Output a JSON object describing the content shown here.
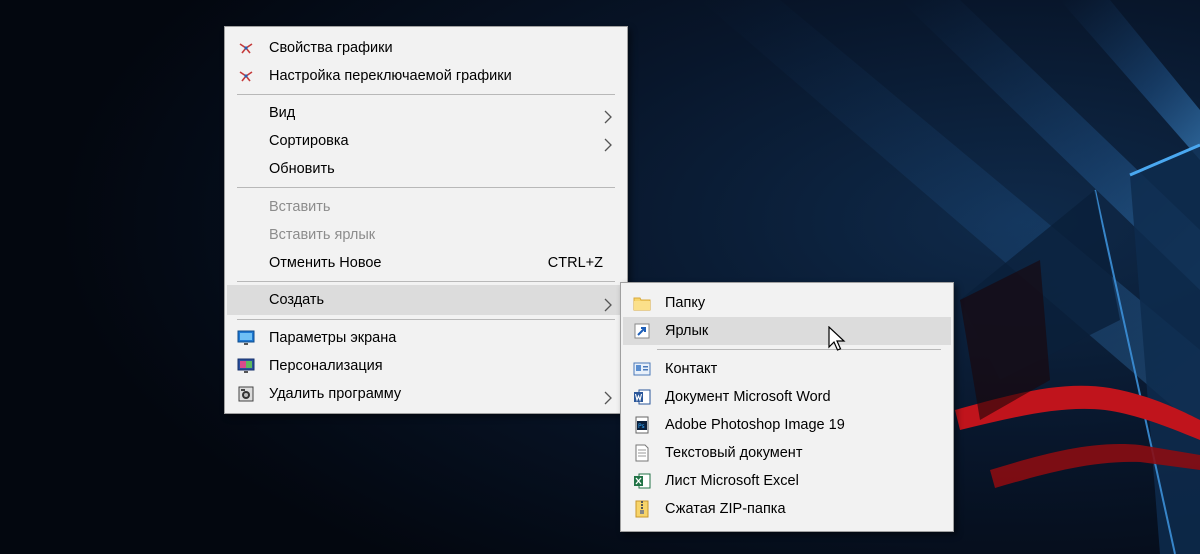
{
  "context_menu": {
    "items": [
      {
        "label": "Свойства графики",
        "icon": "intel-graphics-icon",
        "disabled": false
      },
      {
        "label": "Настройка переключаемой графики",
        "icon": "intel-graphics-icon",
        "disabled": false
      },
      {
        "label": "Вид",
        "has_submenu": true,
        "disabled": false
      },
      {
        "label": "Сортировка",
        "has_submenu": true,
        "disabled": false
      },
      {
        "label": "Обновить",
        "disabled": false
      },
      {
        "label": "Вставить",
        "disabled": true
      },
      {
        "label": "Вставить ярлык",
        "disabled": true
      },
      {
        "label": "Отменить Новое",
        "shortcut": "CTRL+Z",
        "disabled": false
      },
      {
        "label": "Создать",
        "has_submenu": true,
        "highlighted": true,
        "disabled": false
      },
      {
        "label": "Параметры экрана",
        "icon": "display-settings-icon",
        "disabled": false
      },
      {
        "label": "Персонализация",
        "icon": "personalization-icon",
        "disabled": false
      },
      {
        "label": "Удалить программу",
        "icon": "uninstall-icon",
        "has_submenu": true,
        "disabled": false
      }
    ]
  },
  "submenu_create": {
    "items": [
      {
        "label": "Папку",
        "icon": "folder-icon"
      },
      {
        "label": "Ярлык",
        "icon": "shortcut-icon",
        "highlighted": true
      },
      {
        "label": "Контакт",
        "icon": "contact-icon"
      },
      {
        "label": "Документ Microsoft Word",
        "icon": "word-document-icon"
      },
      {
        "label": "Adobe Photoshop Image 19",
        "icon": "photoshop-icon"
      },
      {
        "label": "Текстовый документ",
        "icon": "text-document-icon"
      },
      {
        "label": "Лист Microsoft Excel",
        "icon": "excel-sheet-icon"
      },
      {
        "label": "Сжатая ZIP-папка",
        "icon": "zip-folder-icon"
      }
    ]
  },
  "colors": {
    "menu_background": "#f2f2f2",
    "highlight": "#dcdcdc",
    "disabled_text": "#8c8c8c",
    "desktop_background": "#060d1a"
  }
}
